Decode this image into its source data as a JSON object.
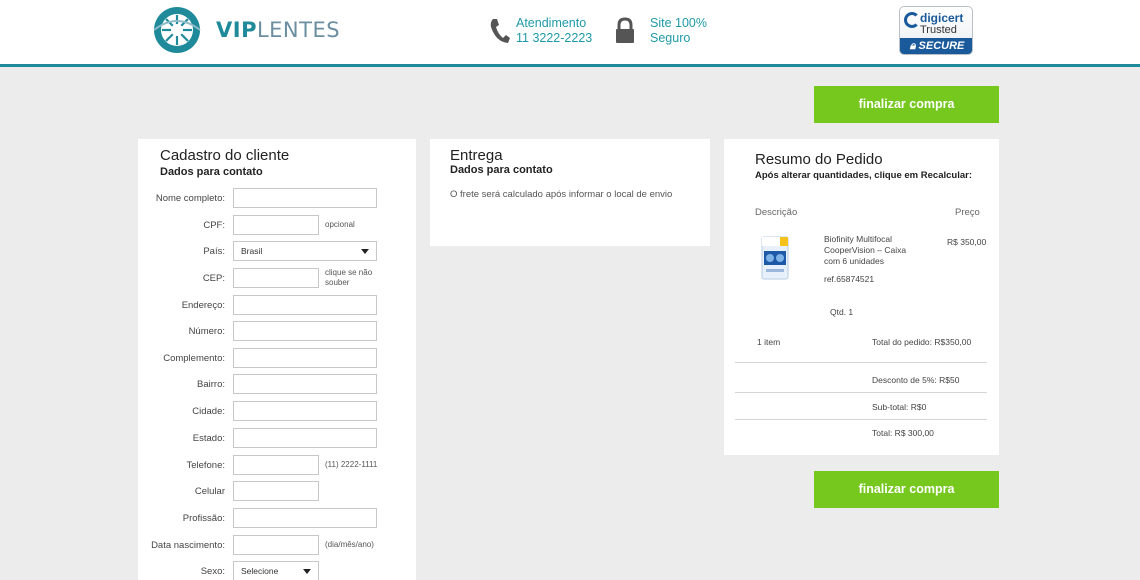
{
  "header": {
    "logo": {
      "vip": "VIP",
      "lentes": "LENTES",
      "icon": "eye-logo-icon"
    },
    "atendimento": {
      "label": "Atendimento",
      "phone": "11 3222-2223",
      "icon": "phone-icon"
    },
    "seguranca": {
      "line1": "Site 100%",
      "line2": "Seguro",
      "icon": "lock-icon"
    },
    "seal": {
      "brand": "digicert",
      "trusted": "Trusted",
      "secure": "SECURE"
    }
  },
  "actions": {
    "finalizar_label": "finalizar compra"
  },
  "cliente": {
    "title": "Cadastro do cliente",
    "subtitle": "Dados para contato",
    "fields": [
      {
        "label": "Nome completo:"
      },
      {
        "label": "CPF:",
        "note": "opcional"
      },
      {
        "label": "País:",
        "value": "Brasil"
      },
      {
        "label": "CEP:",
        "note_line1": "clique se não",
        "note_line2": "souber"
      },
      {
        "label": "Endereço:"
      },
      {
        "label": "Número:"
      },
      {
        "label": "Complemento:"
      },
      {
        "label": "Bairro:"
      },
      {
        "label": "Cidade:"
      },
      {
        "label": "Estado:"
      },
      {
        "label": "Telefone:",
        "note": "(11) 2222-1111"
      },
      {
        "label": "Celular"
      },
      {
        "label": "Profissão:"
      },
      {
        "label": "Data nascimento:",
        "note": "(dia/mês/ano)"
      },
      {
        "label": "Sexo:",
        "value": "Selecione"
      }
    ]
  },
  "entrega": {
    "title": "Entrega",
    "subtitle": "Dados para contato",
    "text": "O frete será calculado após informar o local de envio"
  },
  "resumo": {
    "title": "Resumo do Pedido",
    "subtitle": "Após alterar quantidades, clique em Recalcular:",
    "col_descricao": "Descrição",
    "col_preco": "Preço",
    "product": {
      "name": "Biofinity Multifocal CooperVision – Caixa com 6 unidades",
      "price": "R$ 350,00",
      "ref": "ref.65874521",
      "qtd": "Qtd. 1"
    },
    "items_count": "1 item",
    "total_pedido": "Total do pedido: R$350,00",
    "desconto": "Desconto de 5%: R$50",
    "subtotal": "Sub-total: R$0",
    "total": "Total: R$ 300,00"
  }
}
